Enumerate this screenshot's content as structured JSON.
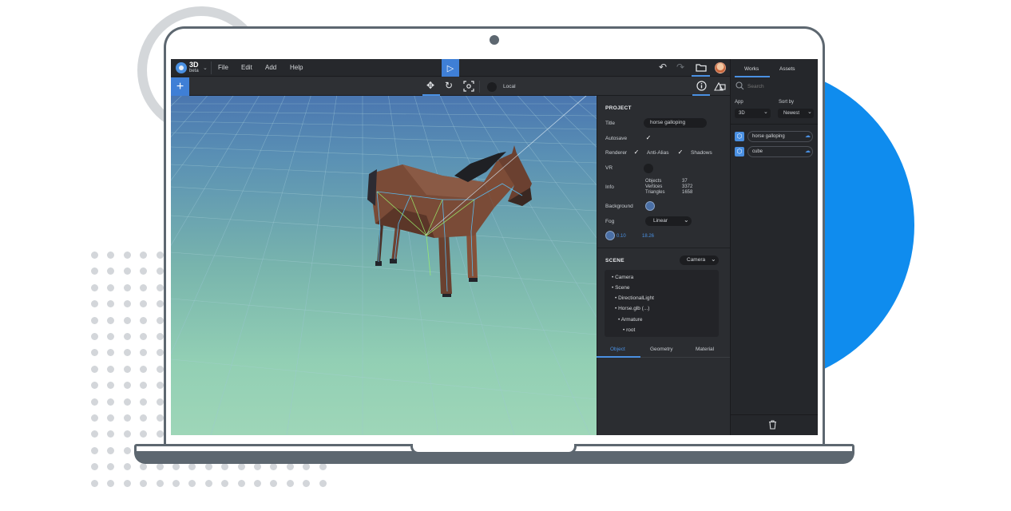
{
  "app": {
    "brand": "3D",
    "brand_sub": "beta"
  },
  "menu": {
    "items": [
      "File",
      "Edit",
      "Add",
      "Help"
    ]
  },
  "toolbar": {
    "space_label": "Local"
  },
  "project": {
    "heading": "PROJECT",
    "title_label": "Title",
    "title_value": "horse galloping",
    "autosave_label": "Autosave",
    "renderer_label": "Renderer",
    "antialias_label": "Anti-Alias",
    "shadows_label": "Shadows",
    "vr_label": "VR",
    "info_label": "Info",
    "info_rows": [
      {
        "label": "Objects",
        "value": "37"
      },
      {
        "label": "Vertices",
        "value": "3372"
      },
      {
        "label": "Triangles",
        "value": "1658"
      }
    ],
    "background_label": "Background",
    "fog_label": "Fog",
    "fog_value": "Linear",
    "fog_near": "0.10",
    "fog_far": "18.26"
  },
  "scene": {
    "heading": "SCENE",
    "camera_select": "Camera",
    "tree": [
      "Camera",
      "Scene",
      "DirectionalLight",
      "Horse.glb  (...)",
      "Armature",
      "root"
    ]
  },
  "object_tabs": [
    "Object",
    "Geometry",
    "Material"
  ],
  "works": {
    "tabs": [
      "Works",
      "Assets"
    ],
    "search_placeholder": "Search",
    "app_label": "App",
    "app_value": "3D",
    "sort_label": "Sort by",
    "sort_value": "Newest",
    "items": [
      "horse galloping",
      "cube"
    ]
  },
  "colors": {
    "accent": "#4a90e2",
    "blob": "#0f8cee",
    "laptop_frame": "#5d6770"
  }
}
